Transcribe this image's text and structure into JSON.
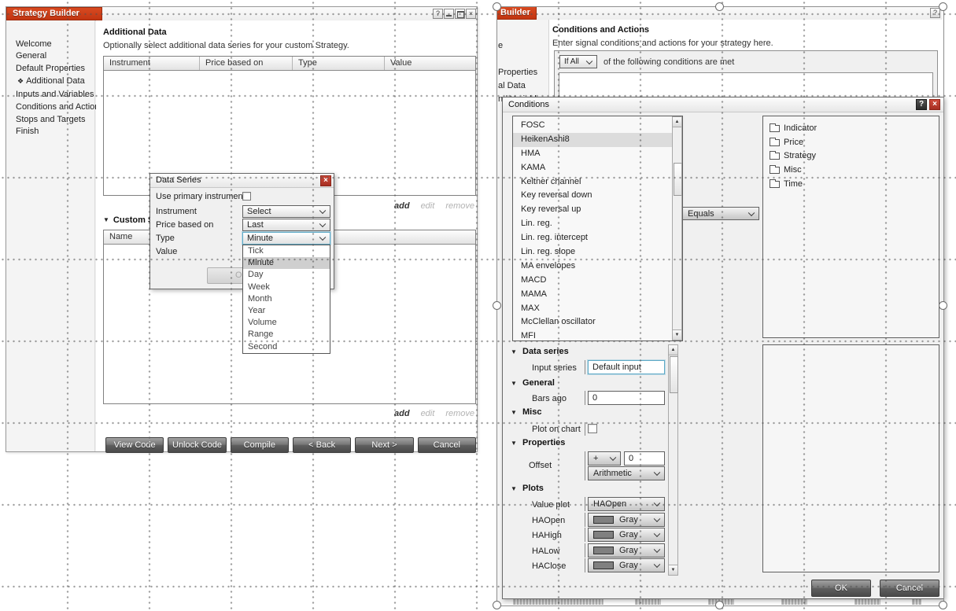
{
  "icons": {
    "collapse": "▼",
    "diamond": "❖",
    "scroll_up": "▲",
    "scroll_down": "▼"
  },
  "colors": {
    "accent_red": "#c23512",
    "swatch_gray": "#808080",
    "focus_blue": "#5ea9c6"
  },
  "left_window": {
    "title": "Strategy Builder",
    "controls": {
      "help": "?",
      "close": "×"
    },
    "sidebar": {
      "items": [
        "Welcome",
        "General",
        "Default Properties",
        "Additional Data",
        "Inputs and Variables",
        "Conditions and Actions",
        "Stops and Targets",
        "Finish"
      ]
    },
    "page": {
      "heading": "Additional Data",
      "subheading": "Optionally select additional data series for your custom Strategy.",
      "table_columns": [
        "Instrument",
        "Price based on",
        "Type",
        "Value"
      ],
      "links": {
        "add": "add",
        "edit": "edit",
        "remove": "remove"
      },
      "custom_series_label": "Custom Series",
      "name_column": "Name",
      "buttons": [
        "View Code",
        "Unlock Code",
        "Compile",
        "< Back",
        "Next >",
        "Cancel"
      ]
    }
  },
  "data_series_dialog": {
    "title": "Data Series",
    "close": "×",
    "labels": {
      "use_primary": "Use primary instrument",
      "instrument": "Instrument",
      "price_based_on": "Price based on",
      "type": "Type",
      "value": "Value"
    },
    "values": {
      "instrument": "Select",
      "price_based_on": "Last",
      "type": "Minute"
    },
    "ok_label": "OK",
    "type_options": [
      "Tick",
      "Minute",
      "Day",
      "Week",
      "Month",
      "Year",
      "Volume",
      "Range",
      "Second"
    ],
    "type_selected": "Minute"
  },
  "right_window": {
    "tab_fragment": "Builder",
    "help": "?",
    "sidebar_fragments": [
      "e",
      "Properties",
      "al Data",
      "nd Variables"
    ],
    "page": {
      "heading": "Conditions and Actions",
      "subheading": "Enter signal conditions and actions for your strategy here.",
      "if_select": "If All",
      "if_text": "of the following conditions are met"
    }
  },
  "conditions_dialog": {
    "title": "Conditions",
    "help": "?",
    "close": "×",
    "list": {
      "items": [
        "FOSC",
        "HeikenAshi8",
        "HMA",
        "KAMA",
        "Keltner channel",
        "Key reversal down",
        "Key reversal up",
        "Lin. reg.",
        "Lin. reg. intercept",
        "Lin. reg. slope",
        "MA envelopes",
        "MACD",
        "MAMA",
        "MAX",
        "McClellan oscillator",
        "MFI"
      ],
      "selected": "HeikenAshi8"
    },
    "operator": "Equals",
    "categories": [
      "Indicator",
      "Price",
      "Strategy",
      "Misc",
      "Time"
    ],
    "sections": {
      "data_series": "Data series",
      "general": "General",
      "misc": "Misc",
      "properties": "Properties",
      "plots": "Plots"
    },
    "rows": {
      "input_series": {
        "label": "Input series",
        "value": "Default input"
      },
      "bars_ago": {
        "label": "Bars ago",
        "value": "0"
      },
      "plot_on_chart": {
        "label": "Plot on chart",
        "checked": false
      },
      "offset": {
        "label": "Offset",
        "sign": "+",
        "num": "0",
        "mode": "Arithmetic"
      },
      "value_plot": {
        "label": "Value plot",
        "value": "HAOpen"
      }
    },
    "plots": [
      {
        "label": "HAOpen",
        "value": "Gray"
      },
      {
        "label": "HAHigh",
        "value": "Gray"
      },
      {
        "label": "HALow",
        "value": "Gray"
      },
      {
        "label": "HAClose",
        "value": "Gray"
      }
    ],
    "ok": "OK",
    "cancel": "Cancel"
  }
}
